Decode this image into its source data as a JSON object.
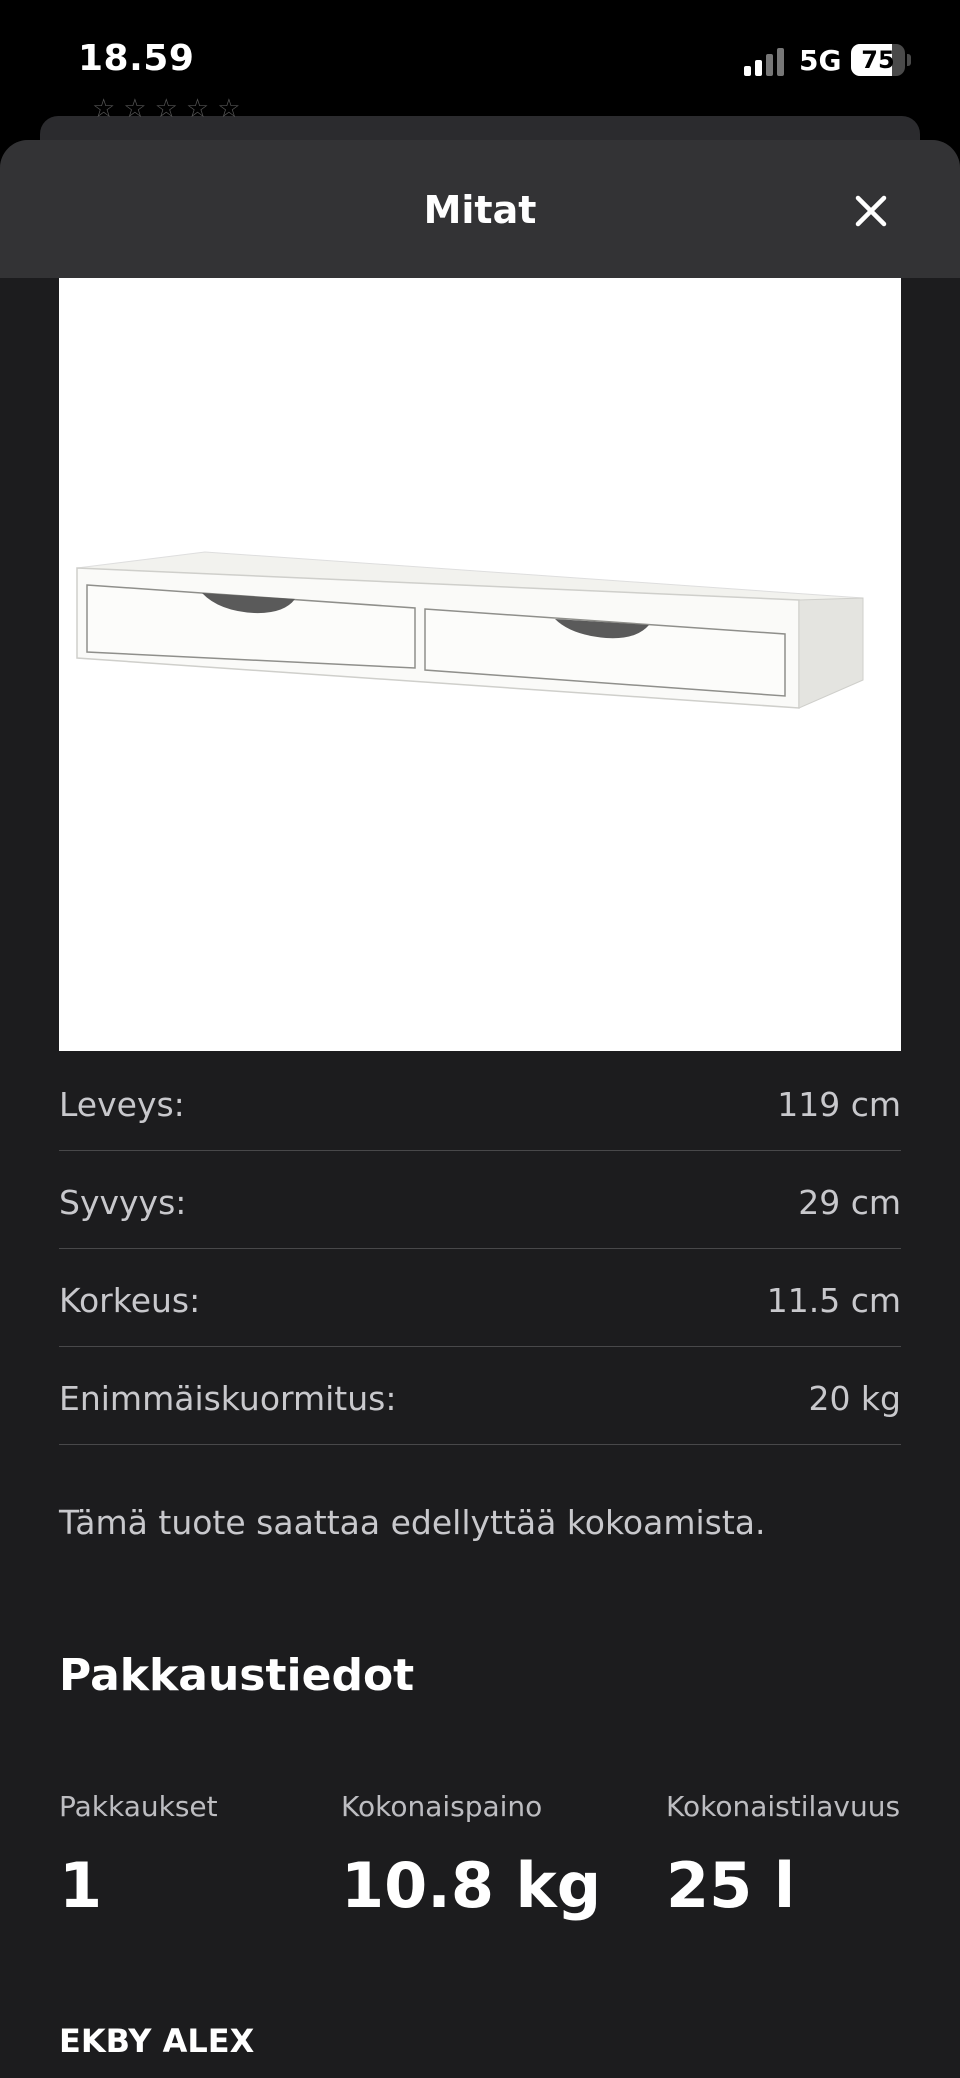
{
  "status_bar": {
    "time": "18.59",
    "network": "5G",
    "battery": "75",
    "battery_level": 0.75
  },
  "sheet": {
    "title": "Mitat",
    "close_icon": "close-icon"
  },
  "product_image": {
    "description_icon": "shelf-with-drawers-image"
  },
  "dimensions": [
    {
      "label": "Leveys:",
      "value": "119 cm"
    },
    {
      "label": "Syvyys:",
      "value": "29 cm"
    },
    {
      "label": "Korkeus:",
      "value": "11.5 cm"
    },
    {
      "label": "Enimmäiskuormitus:",
      "value": "20 kg"
    }
  ],
  "assembly_note": "Tämä tuote saattaa edellyttää kokoamista.",
  "package_info": {
    "heading": "Pakkaustiedot",
    "columns": [
      {
        "label": "Pakkaukset",
        "value": "1"
      },
      {
        "label": "Kokonaispaino",
        "value": "10.8 kg"
      },
      {
        "label": "Kokonaistilavuus",
        "value": "25 l"
      }
    ]
  },
  "product_name": "EKBY ALEX",
  "colors": {
    "sheet_bg": "#1c1c1e",
    "header_bg": "#333335",
    "divider": "#48484a"
  }
}
